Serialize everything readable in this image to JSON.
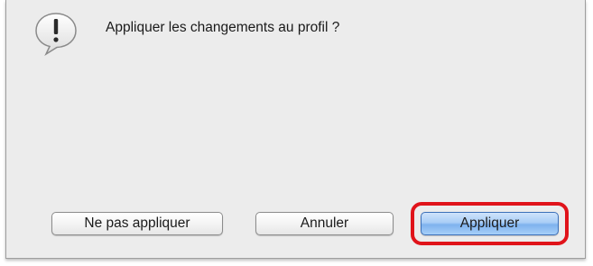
{
  "dialog": {
    "icon": "alert-exclamation-icon",
    "message": "Appliquer les changements au profil ?",
    "buttons": {
      "dont_apply": "Ne pas appliquer",
      "cancel": "Annuler",
      "apply": "Appliquer"
    },
    "highlighted_button": "apply"
  },
  "colors": {
    "dialog_background": "#ececec",
    "default_button": "#a9cdf6",
    "highlight": "#e0131a"
  }
}
